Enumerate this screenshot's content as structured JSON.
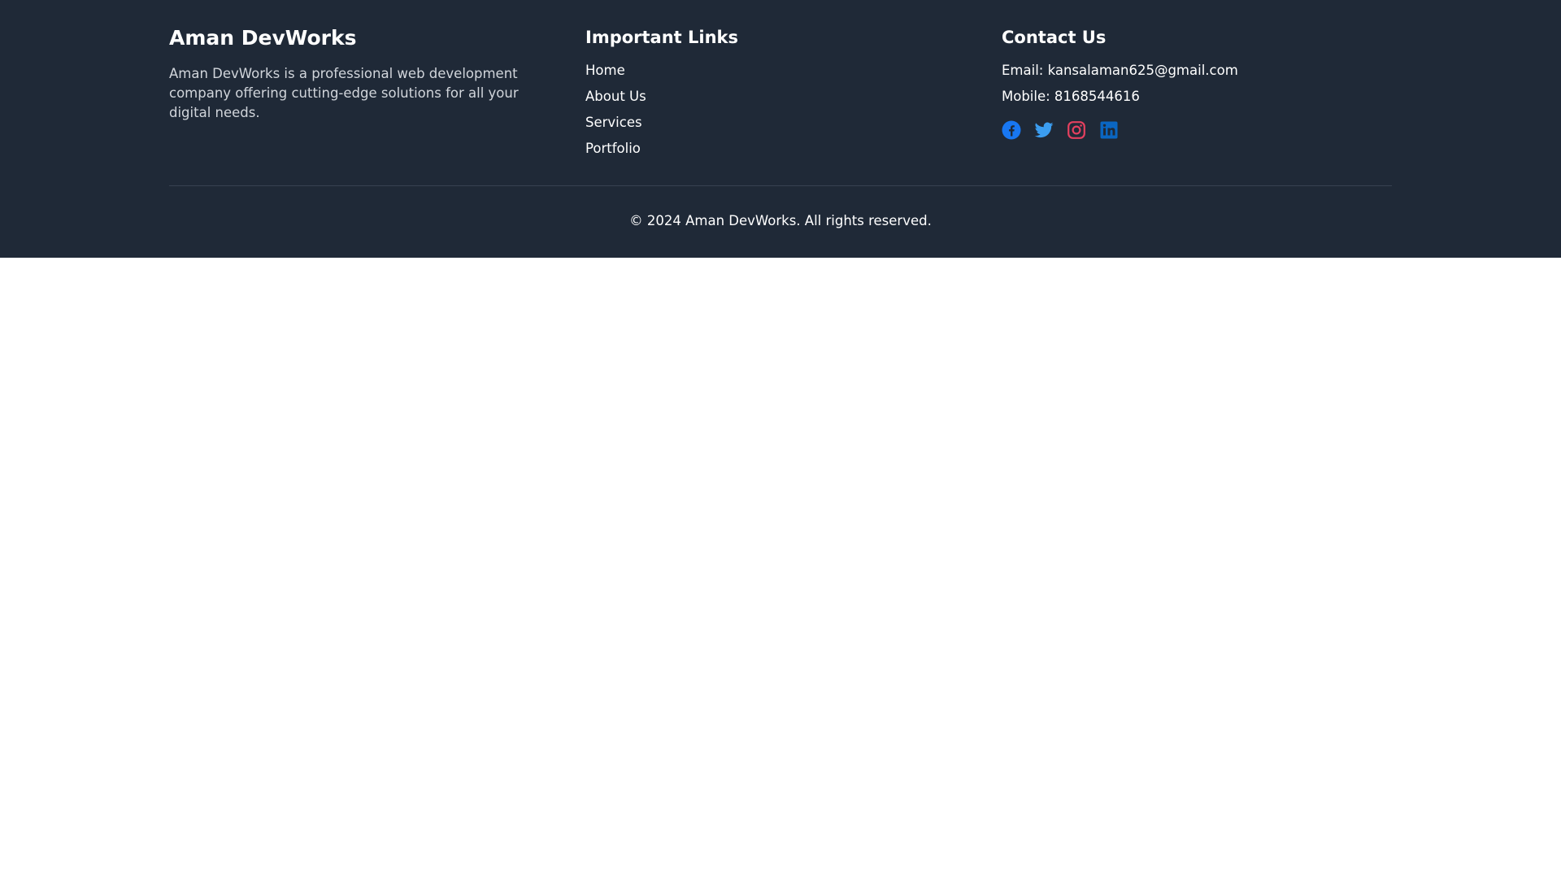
{
  "brand": {
    "title": "Aman DevWorks",
    "description": "Aman DevWorks is a professional web development company offering cutting-edge solutions for all your digital needs."
  },
  "links": {
    "heading": "Important Links",
    "items": [
      {
        "label": "Home"
      },
      {
        "label": "About Us"
      },
      {
        "label": "Services"
      },
      {
        "label": "Portfolio"
      }
    ]
  },
  "contact": {
    "heading": "Contact Us",
    "email": "Email: kansalaman625@gmail.com",
    "mobile": "Mobile: 8168544616",
    "socials": [
      {
        "icon": "facebook-icon",
        "color": "#1877f2"
      },
      {
        "icon": "twitter-icon",
        "color": "#3b9df0"
      },
      {
        "icon": "instagram-icon",
        "color": "#e4405f"
      },
      {
        "icon": "linkedin-icon",
        "color": "#0a66c2"
      }
    ]
  },
  "copyright": "© 2024 Aman DevWorks. All rights reserved.",
  "colors": {
    "footer_bg": "#1f2937",
    "text": "#ffffff",
    "muted_text": "#d1d5db",
    "divider": "#374151"
  }
}
